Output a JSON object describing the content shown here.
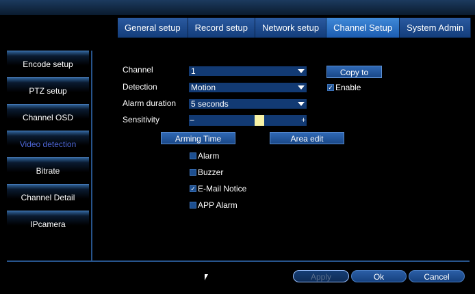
{
  "top_tabs": [
    {
      "label": "General setup"
    },
    {
      "label": "Record setup"
    },
    {
      "label": "Network setup"
    },
    {
      "label": "Channel Setup"
    },
    {
      "label": "System Admin"
    }
  ],
  "sidebar": {
    "items": [
      {
        "label": "Encode setup"
      },
      {
        "label": "PTZ setup"
      },
      {
        "label": "Channel OSD"
      },
      {
        "label": "Video detection"
      },
      {
        "label": "Bitrate"
      },
      {
        "label": "Channel Detail"
      },
      {
        "label": "IPcamera"
      }
    ]
  },
  "form": {
    "channel_label": "Channel",
    "channel_value": "1",
    "detection_label": "Detection",
    "detection_value": "Motion",
    "alarm_duration_label": "Alarm duration",
    "alarm_duration_value": "5 seconds",
    "sensitivity_label": "Sensitivity",
    "sensitivity_level": 0.62,
    "copy_to_label": "Copy to",
    "enable_label": "Enable",
    "enable_checked": true,
    "arming_time_label": "Arming Time",
    "area_edit_label": "Area edit"
  },
  "options": [
    {
      "label": "Alarm",
      "checked": false
    },
    {
      "label": "Buzzer",
      "checked": false
    },
    {
      "label": "E-Mail Notice",
      "checked": true
    },
    {
      "label": "APP Alarm",
      "checked": false
    }
  ],
  "footer": {
    "apply_label": "Apply",
    "ok_label": "Ok",
    "cancel_label": "Cancel"
  },
  "colors": {
    "accent": "#1c5cb0",
    "active_sidebar_text": "#4d66d6",
    "slider_thumb": "#f8f3a6"
  }
}
